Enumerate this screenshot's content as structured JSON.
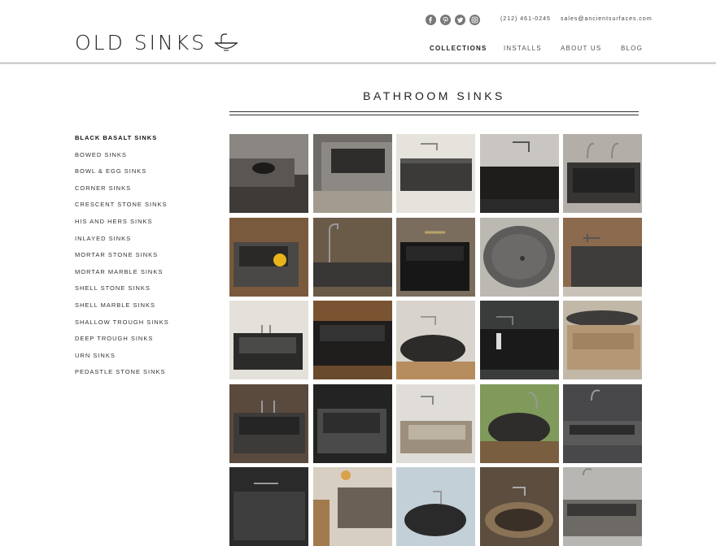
{
  "logo": {
    "text": "OLD SINKS",
    "icon": "sink-bowl-icon"
  },
  "contact": {
    "phone": "(212) 461-0245",
    "email": "sales@ancientsurfaces.com"
  },
  "social": [
    "facebook-icon",
    "pinterest-icon",
    "twitter-icon",
    "instagram-icon"
  ],
  "nav": [
    {
      "label": "COLLECTIONS",
      "active": true
    },
    {
      "label": "INSTALLS",
      "active": false
    },
    {
      "label": "ABOUT US",
      "active": false
    },
    {
      "label": "BLOG",
      "active": false
    }
  ],
  "page": {
    "title": "BATHROOM SINKS"
  },
  "sidebar": {
    "items": [
      {
        "label": "BLACK BASALT SINKS",
        "active": true
      },
      {
        "label": "BOWED SINKS"
      },
      {
        "label": "BOWL & EGG SINKS"
      },
      {
        "label": "CORNER SINKS"
      },
      {
        "label": "CRESCENT STONE SINKS"
      },
      {
        "label": "HIS AND HERS SINKS"
      },
      {
        "label": "INLAYED SINKS"
      },
      {
        "label": "MORTAR STONE SINKS"
      },
      {
        "label": "MORTAR MARBLE SINKS"
      },
      {
        "label": "SHELL STONE SINKS"
      },
      {
        "label": "SHELL MARBLE SINKS"
      },
      {
        "label": "SHALLOW TROUGH SINKS"
      },
      {
        "label": "DEEP TROUGH SINKS"
      },
      {
        "label": "URN SINKS"
      },
      {
        "label": "PEDASTLE STONE SINKS"
      }
    ]
  },
  "colors": {
    "rule": "#333333",
    "header_border": "#a8a8a8",
    "social_icon": "#777777"
  }
}
